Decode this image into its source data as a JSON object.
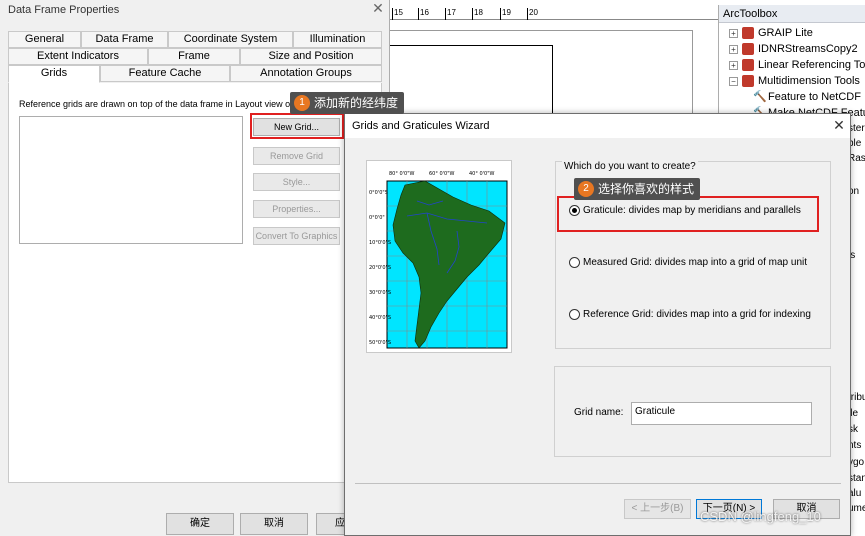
{
  "data_frame_properties": {
    "title": "Data Frame Properties",
    "close": "✕",
    "tabs_row1": [
      "General",
      "Data Frame",
      "Coordinate System",
      "Illumination"
    ],
    "tabs_row2": [
      "Extent Indicators",
      "Frame",
      "Size and Position"
    ],
    "tabs_row3": [
      "Grids",
      "Feature Cache",
      "Annotation Groups"
    ],
    "active_tab": "Grids",
    "description": "Reference grids are drawn on top of the data frame in Layout view only.",
    "buttons": {
      "new_grid": "New Grid...",
      "remove_grid": "Remove Grid",
      "style": "Style...",
      "properties": "Properties...",
      "convert": "Convert To Graphics"
    },
    "bottom_buttons": {
      "ok": "确定",
      "cancel": "取消",
      "apply": "应"
    }
  },
  "layout": {
    "ruler_numbers": [
      "15",
      "16",
      "17",
      "18",
      "19",
      "20"
    ]
  },
  "arctoolbox": {
    "title": "ArcToolbox",
    "items": [
      {
        "label": "GRAIP Lite",
        "expand": "+"
      },
      {
        "label": "IDNRStreamsCopy2",
        "expand": "+"
      },
      {
        "label": "Linear Referencing Tools",
        "expand": "+"
      },
      {
        "label": "Multidimension Tools",
        "expand": "−"
      }
    ],
    "subitems": [
      "Feature to NetCDF",
      "Make NetCDF Feature"
    ],
    "fragments": [
      "ster",
      "ble",
      "Ras",
      "on",
      "is",
      "tribu",
      "ile",
      "sk",
      "nts",
      "ygo",
      "stan",
      "alu",
      "ume"
    ]
  },
  "wizard": {
    "title": "Grids and Graticules Wizard",
    "close": "✕",
    "question": "Which do you want to create?",
    "options": [
      {
        "label": "Graticule: divides map by meridians and parallels",
        "checked": true
      },
      {
        "label": "Measured Grid: divides map into a grid of map unit",
        "checked": false
      },
      {
        "label": "Reference Grid: divides map into a grid for indexing",
        "checked": false
      }
    ],
    "grid_name_label": "Grid name:",
    "grid_name_value": "Graticule",
    "buttons": {
      "back": "< 上一步(B)",
      "next": "下一页(N) >",
      "cancel": "取消"
    },
    "map_preview": {
      "top_labels": [
        "80° 0'0\"W",
        "60° 0'0\"W",
        "40° 0'0\"W"
      ],
      "left_labels": [
        "0°0'0\"S",
        "0°0'0\"",
        "10°0'0\"S",
        "20°0'0\"S",
        "30°0'0\"S",
        "40°0'0\"S",
        "50°0'0\"S"
      ],
      "ocean_color": "#00e5ff",
      "land_color": "#1e6b1e"
    }
  },
  "callouts": [
    {
      "num": "1",
      "text": "添加新的经纬度"
    },
    {
      "num": "2",
      "text": "选择你喜欢的样式"
    }
  ],
  "watermark": "CSDN @lingfeng_10"
}
